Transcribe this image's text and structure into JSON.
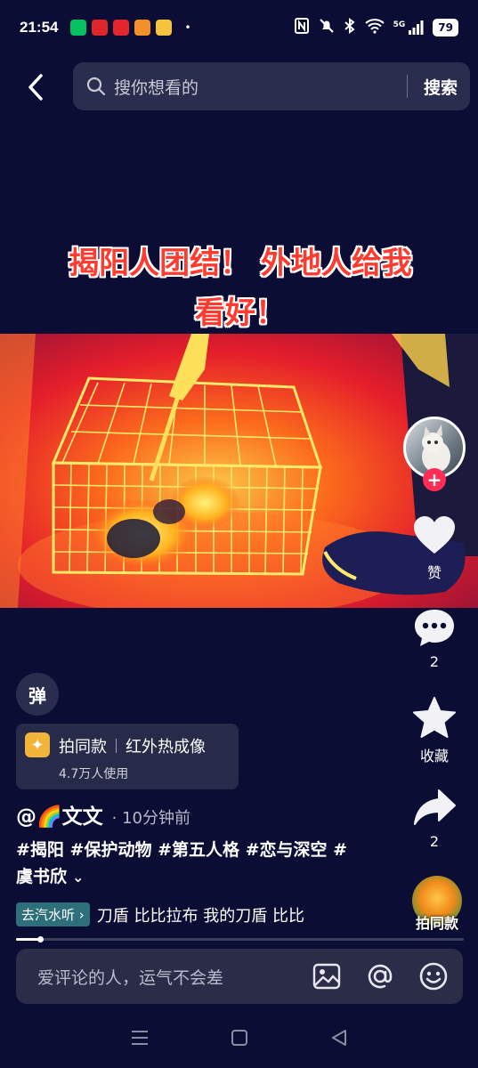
{
  "status_bar": {
    "time": "21:54",
    "apps": [
      {
        "name": "wechat-app-icon",
        "color": "#07c160"
      },
      {
        "name": "news-app-icon",
        "color": "#e0262b"
      },
      {
        "name": "netease-music-app-icon",
        "color": "#e3262d"
      },
      {
        "name": "app-icon-orange",
        "color": "#f4902a"
      },
      {
        "name": "video-app-icon",
        "color": "#f6c33c"
      }
    ],
    "more": "•",
    "network": "5G",
    "battery": "79"
  },
  "search": {
    "placeholder": "搜你想看的",
    "button_label": "搜索"
  },
  "video": {
    "title_line1": "揭阳人团结！ 外地人给我",
    "title_line2": "看好！"
  },
  "rail": {
    "like_label": "赞",
    "comment_count": "2",
    "favorite_label": "收藏",
    "share_count": "2",
    "samestyle_label": "拍同款"
  },
  "danmaku": {
    "label": "弹"
  },
  "effect": {
    "action": "拍同款",
    "name": "红外热成像",
    "usage": "4.7万人使用"
  },
  "author": {
    "name": "@🌈文文",
    "time": "· 10分钟前"
  },
  "caption": {
    "text": "#揭阳 #保护动物 #第五人格 #恋与深空 #虞书欣",
    "expand": "⌄"
  },
  "music": {
    "tag": "去汽水听 ›",
    "text": "刀盾   比比拉布 我的刀盾   比比"
  },
  "progress": {
    "fraction": 0.05
  },
  "comment_bar": {
    "placeholder": "爱评论的人，运气不会差"
  }
}
